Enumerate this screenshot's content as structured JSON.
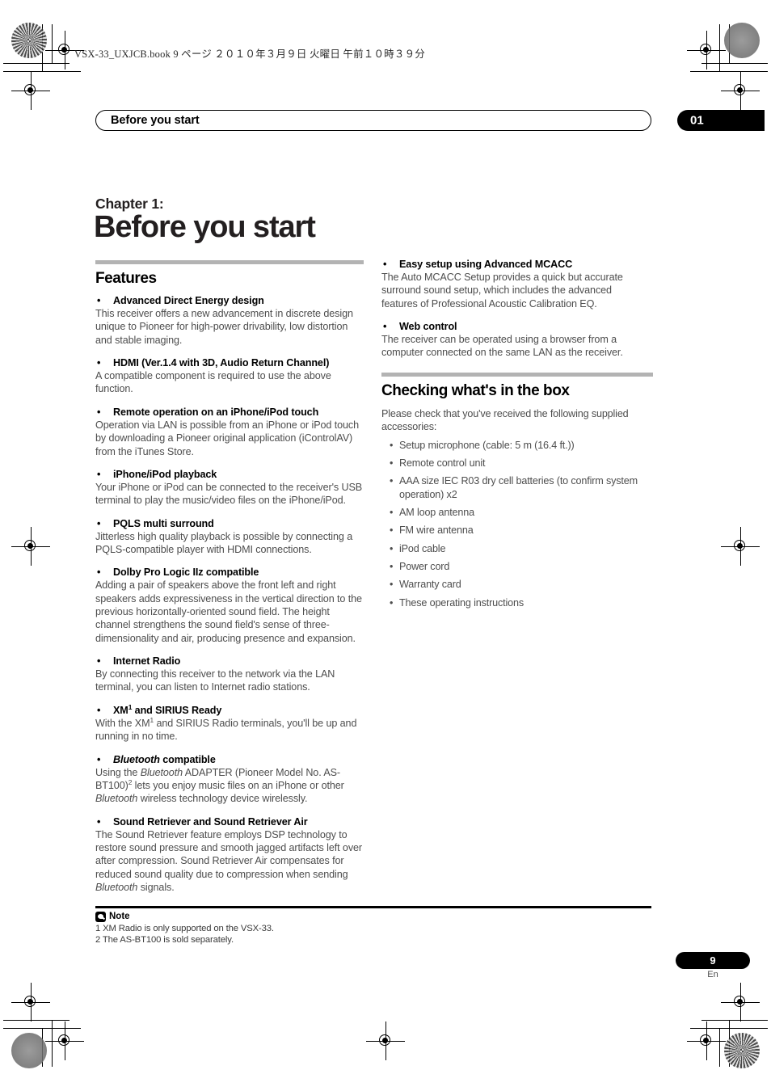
{
  "print_marks": {
    "file_stamp": "VSX-33_UXJCB.book   9 ページ   ２０１０年３月９日   火曜日   午前１０時３９分"
  },
  "running_head": {
    "title": "Before you start",
    "chapter_number": "01"
  },
  "chapter": {
    "label": "Chapter 1:",
    "title": "Before you start"
  },
  "left_column": {
    "section_title": "Features",
    "features": [
      {
        "heading": "Advanced Direct Energy design",
        "body": "This receiver offers a new advancement in discrete design unique to Pioneer for high-power drivability, low distortion and stable imaging."
      },
      {
        "heading": "HDMI (Ver.1.4 with 3D, Audio Return Channel)",
        "body": "A compatible component is required to use the above function."
      },
      {
        "heading": "Remote operation on an iPhone/iPod touch",
        "body": "Operation via LAN is possible from an iPhone or iPod touch by downloading a Pioneer original application (iControlAV) from the iTunes Store."
      },
      {
        "heading": "iPhone/iPod playback",
        "body": "Your iPhone or iPod can be connected to the receiver's USB terminal to play the music/video files on the iPhone/iPod."
      },
      {
        "heading": "PQLS multi surround",
        "body": "Jitterless high quality playback is possible by connecting a PQLS-compatible player with HDMI connections."
      },
      {
        "heading": "Dolby Pro Logic IIz compatible",
        "body": "Adding a pair of speakers above the front left and right speakers adds expressiveness in the vertical direction to the previous horizontally-oriented sound field. The height channel strengthens the sound field's sense of three-dimensionality and air, producing presence and expansion."
      },
      {
        "heading": "Internet Radio",
        "body": "By connecting this receiver to the network via the LAN terminal, you can listen to Internet radio stations."
      },
      {
        "heading_html": "XM<sup>1</sup> and SIRIUS Ready",
        "body_html": "With the XM<sup>1</sup> and SIRIUS Radio terminals, you'll be up and running in no time."
      },
      {
        "heading_html": "<i>Bluetooth</i> compatible",
        "body_html": "Using the <i>Bluetooth</i> ADAPTER (Pioneer Model No. AS-BT100)<sup>2</sup> lets you enjoy music files on an iPhone or other <i>Bluetooth</i> wireless technology device wirelessly."
      },
      {
        "heading": "Sound Retriever and Sound Retriever Air",
        "body_html": "The Sound Retriever feature employs DSP technology to restore sound pressure and smooth jagged artifacts left over after compression. Sound Retriever Air compensates for reduced sound quality due to compression when sending <i>Bluetooth</i> signals."
      }
    ]
  },
  "right_column": {
    "features": [
      {
        "heading": "Easy setup using Advanced MCACC",
        "body": "The Auto MCACC Setup provides a quick but accurate surround sound setup, which includes the advanced features of Professional Acoustic Calibration EQ."
      },
      {
        "heading": "Web control",
        "body": "The receiver can be operated using a browser from a computer connected on the same LAN as the receiver."
      }
    ],
    "section_title": "Checking what's in the box",
    "intro": "Please check that you've received the following supplied accessories:",
    "accessories": [
      "Setup microphone (cable: 5 m (16.4 ft.))",
      "Remote control unit",
      "AAA size IEC R03 dry cell batteries (to confirm system operation) x2",
      "AM loop antenna",
      "FM wire antenna",
      "iPod cable",
      "Power cord",
      "Warranty card",
      "These operating instructions"
    ]
  },
  "note": {
    "label": "Note",
    "lines": [
      "1 XM Radio is only supported on the VSX-33.",
      "2 The AS-BT100 is sold separately."
    ]
  },
  "footer": {
    "page_number": "9",
    "language": "En"
  },
  "colors": {
    "rule_gray": "#b3b3b3",
    "body_text": "#4d4d4d",
    "heading_text": "#000000"
  }
}
